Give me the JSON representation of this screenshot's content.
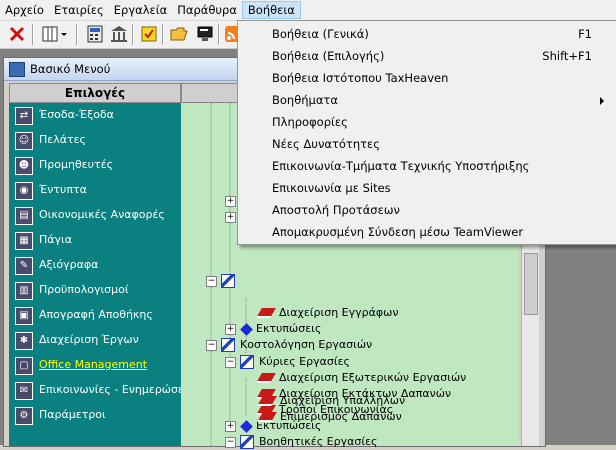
{
  "menubar": {
    "items": [
      "Αρχείο",
      "Εταιρίες",
      "Εργαλεία",
      "Παράθυρα",
      "Βοήθεια"
    ]
  },
  "panel": {
    "title": "Βασικό Μενού",
    "left_header": "Επιλογές"
  },
  "sidebar": {
    "items": [
      {
        "label": "Έσοδα-Έξοδα",
        "icon": "income-expense-icon"
      },
      {
        "label": "Πελάτες",
        "icon": "customers-icon"
      },
      {
        "label": "Προμηθευτές",
        "icon": "suppliers-icon"
      },
      {
        "label": "Έντυπτα",
        "icon": "forms-icon"
      },
      {
        "label": "Οικονομικές Αναφορές",
        "icon": "financial-reports-icon"
      },
      {
        "label": "Πάγια",
        "icon": "fixed-assets-icon"
      },
      {
        "label": "Αξιόγραφα",
        "icon": "securities-icon"
      },
      {
        "label": "Προϋπολογισμοί",
        "icon": "budgets-icon"
      },
      {
        "label": "Απογραφή Αποθήκης",
        "icon": "inventory-icon"
      },
      {
        "label": "Διαχείριση Έργων",
        "icon": "projects-icon"
      },
      {
        "label": "Office Management",
        "icon": "office-management-icon",
        "active": true
      },
      {
        "label": "Επικοινωνίες - Ενημερώσεις",
        "icon": "communications-icon"
      },
      {
        "label": "Παράμετροι",
        "icon": "parameters-icon"
      }
    ]
  },
  "tree": {
    "nodes": [
      {
        "label": "Διαχείριση Εγγράφων"
      },
      {
        "label": "Εκτυπώσεις"
      },
      {
        "label": "Κοστολόγηση Εργασιών"
      },
      {
        "label": "Κύριες Εργασίες"
      },
      {
        "label": "Διαχείριση Εξωτερικών Εργασιών"
      },
      {
        "label": "Διαχείριση Εκτάκτων Δαπανών"
      },
      {
        "label": "Τρόποι Επικοινωνίας"
      },
      {
        "label": "Εκτυπώσεις"
      },
      {
        "label": "Βοηθητικές Εργασίες"
      },
      {
        "label": "Διαχείριση Υπαλλήλων"
      },
      {
        "label": "Επιμερισμός Δαπανών"
      }
    ]
  },
  "help_menu": {
    "items": [
      {
        "label": "Βοήθεια (Γενικά)",
        "shortcut": "F1"
      },
      {
        "label": "Βοήθεια (Επιλογής)",
        "shortcut": "Shift+F1"
      },
      {
        "label": "Βοήθεια Ιστότοπου TaxHeaven",
        "shortcut": ""
      },
      {
        "label": "Βοηθήματα",
        "shortcut": ""
      },
      {
        "label": "Πληροφορίες",
        "shortcut": ""
      },
      {
        "label": "Νέες Δυνατότητες",
        "shortcut": ""
      },
      {
        "label": "Επικοινωνία-Τμήματα Τεχνικής Υποστήριξης",
        "shortcut": ""
      },
      {
        "label": "Επικοινωνία με Sites",
        "shortcut": ""
      },
      {
        "label": "Αποστολή Προτάσεων",
        "shortcut": ""
      },
      {
        "label": "Απομακρυσμένη Σύνδεση μέσω TeamViewer",
        "shortcut": ""
      }
    ]
  },
  "colors": {
    "sidebar_bg": "#0a8080",
    "tree_bg": "#c0e8c0",
    "active_item": "#ffff00"
  }
}
